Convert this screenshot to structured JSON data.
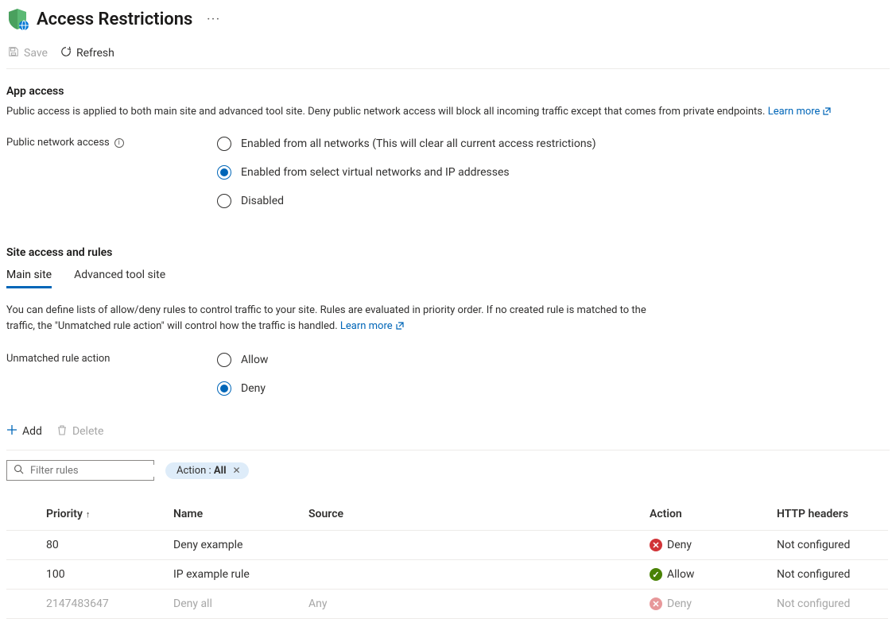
{
  "header": {
    "title": "Access Restrictions"
  },
  "toolbar": {
    "save": "Save",
    "refresh": "Refresh"
  },
  "appAccess": {
    "heading": "App access",
    "desc": "Public access is applied to both main site and advanced tool site. Deny public network access will block all incoming traffic except that comes from private endpoints.",
    "learnMore": "Learn more",
    "field_label": "Public network access",
    "options": {
      "opt1": "Enabled from all networks (This will clear all current access restrictions)",
      "opt2": "Enabled from select virtual networks and IP addresses",
      "opt3": "Disabled"
    },
    "selected": "opt2"
  },
  "siteAccess": {
    "heading": "Site access and rules",
    "tabs": {
      "main": "Main site",
      "adv": "Advanced tool site"
    },
    "desc": "You can define lists of allow/deny rules to control traffic to your site. Rules are evaluated in priority order. If no created rule is matched to the traffic, the \"Unmatched rule action\" will control how the traffic is handled.",
    "learnMore": "Learn more",
    "unmatched_label": "Unmatched rule action",
    "unmatched_options": {
      "allow": "Allow",
      "deny": "Deny"
    },
    "unmatched_selected": "deny"
  },
  "rulesBar": {
    "add": "Add",
    "delete": "Delete",
    "search_placeholder": "Filter rules",
    "pill_label": "Action : ",
    "pill_value": "All"
  },
  "table": {
    "headers": {
      "priority": "Priority",
      "name": "Name",
      "source": "Source",
      "action": "Action",
      "http": "HTTP headers"
    },
    "rows": [
      {
        "priority": "80",
        "name": "Deny example",
        "source": "",
        "action": "Deny",
        "action_kind": "deny",
        "http": "Not configured",
        "faded": false
      },
      {
        "priority": "100",
        "name": "IP example rule",
        "source": "",
        "action": "Allow",
        "action_kind": "allow",
        "http": "Not configured",
        "faded": false
      },
      {
        "priority": "2147483647",
        "name": "Deny all",
        "source": "Any",
        "action": "Deny",
        "action_kind": "deny",
        "http": "Not configured",
        "faded": true
      }
    ]
  }
}
